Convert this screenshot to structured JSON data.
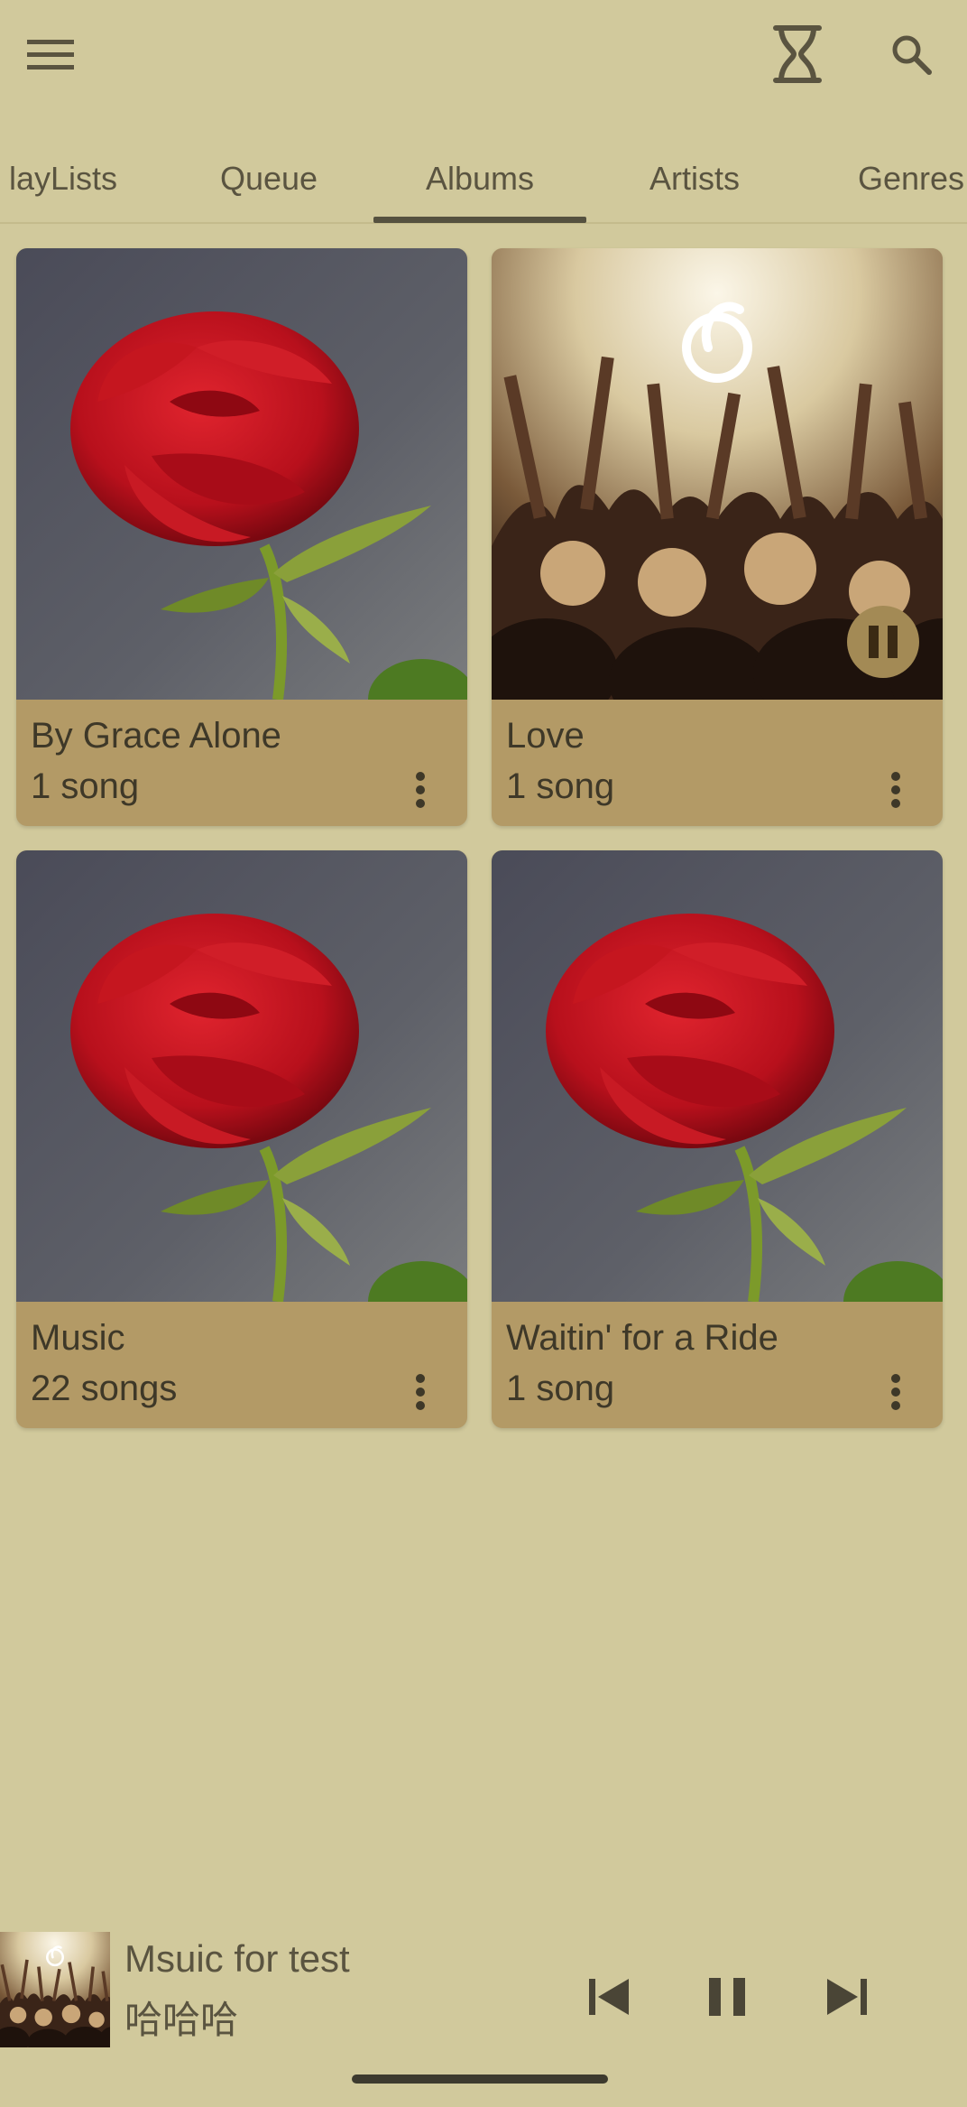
{
  "appbar": {
    "menu_icon": "hamburger-menu-icon",
    "timer_icon": "hourglass-icon",
    "search_icon": "search-icon"
  },
  "tabs": [
    {
      "label": "layLists"
    },
    {
      "label": "Queue"
    },
    {
      "label": "Albums",
      "selected": true
    },
    {
      "label": "Artists"
    },
    {
      "label": "Genres"
    }
  ],
  "albums": [
    {
      "title": "By Grace Alone",
      "subtitle": "1 song",
      "cover": "red-rose"
    },
    {
      "title": "Love",
      "subtitle": "1 song",
      "cover": "concert-crowd",
      "playing": true
    },
    {
      "title": "Music",
      "subtitle": "22 songs",
      "cover": "red-rose"
    },
    {
      "title": "Waitin' for a Ride",
      "subtitle": "1 song",
      "cover": "red-rose"
    }
  ],
  "mini_player": {
    "title": "Msuic for test",
    "artist": "哈哈哈",
    "cover": "concert-crowd"
  },
  "colors": {
    "background": "#d1c99c",
    "card": "#b39a66",
    "accent": "#55513f"
  }
}
